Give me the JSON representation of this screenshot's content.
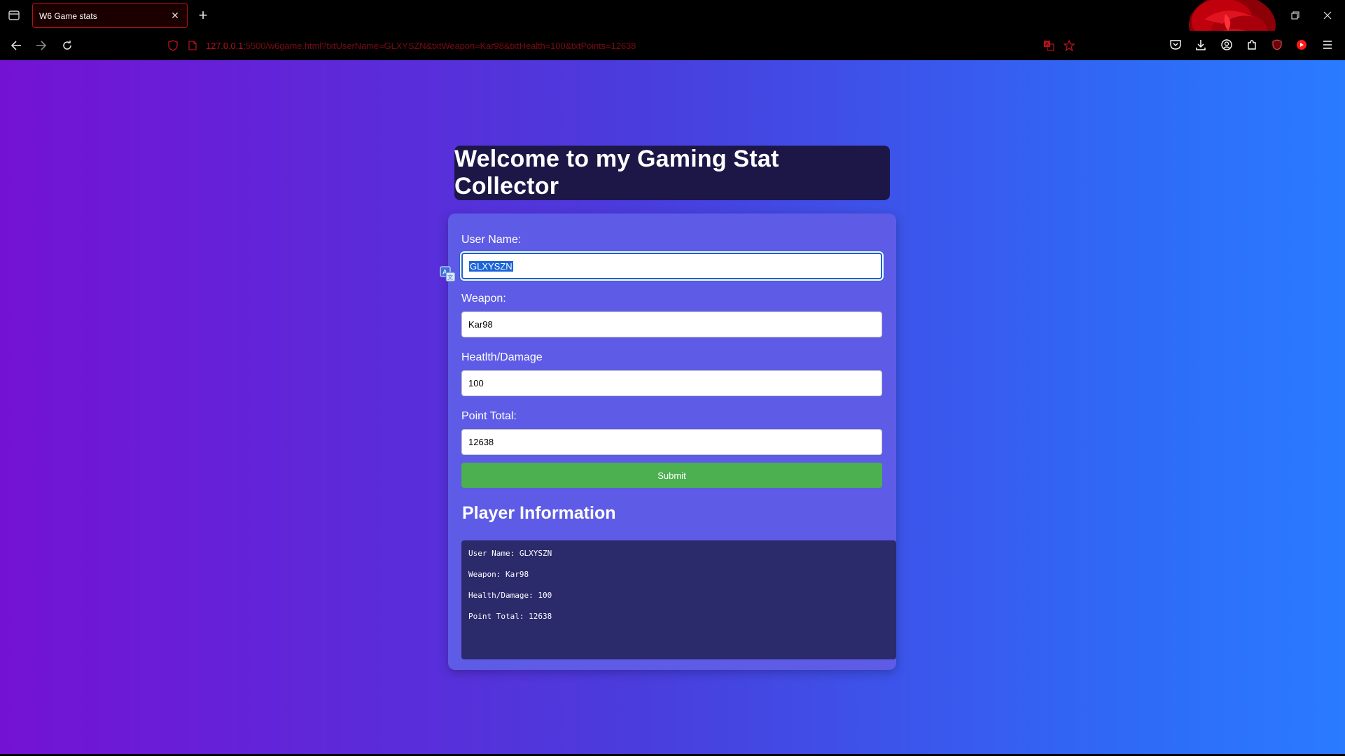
{
  "browser": {
    "tab_title": "W6 Game stats",
    "url_host": "127.0.0.1",
    "url_rest": ":5500/w6game.html?txtUserName=GLXYSZN&txtWeapon=Kar98&txtHealth=100&txtPoints=12638",
    "accent_color": "#b3121a"
  },
  "page": {
    "heading": "Welcome to my Gaming Stat Collector",
    "form": {
      "username_label": "User Name:",
      "username_value": "GLXYSZN",
      "weapon_label": "Weapon:",
      "weapon_value": "Kar98",
      "health_label": "Heatlth/Damage",
      "health_value": "100",
      "points_label": "Point Total:",
      "points_value": "12638",
      "submit_label": "Submit"
    },
    "player_info": {
      "title": "Player Information",
      "lines": [
        "User Name: GLXYSZN",
        "Weapon: Kar98",
        "Health/Damage: 100",
        "Point Total: 12638"
      ]
    },
    "colors": {
      "gradient_start": "#7412d4",
      "gradient_end": "#2a7bff",
      "submit_green": "#4caf50"
    }
  }
}
